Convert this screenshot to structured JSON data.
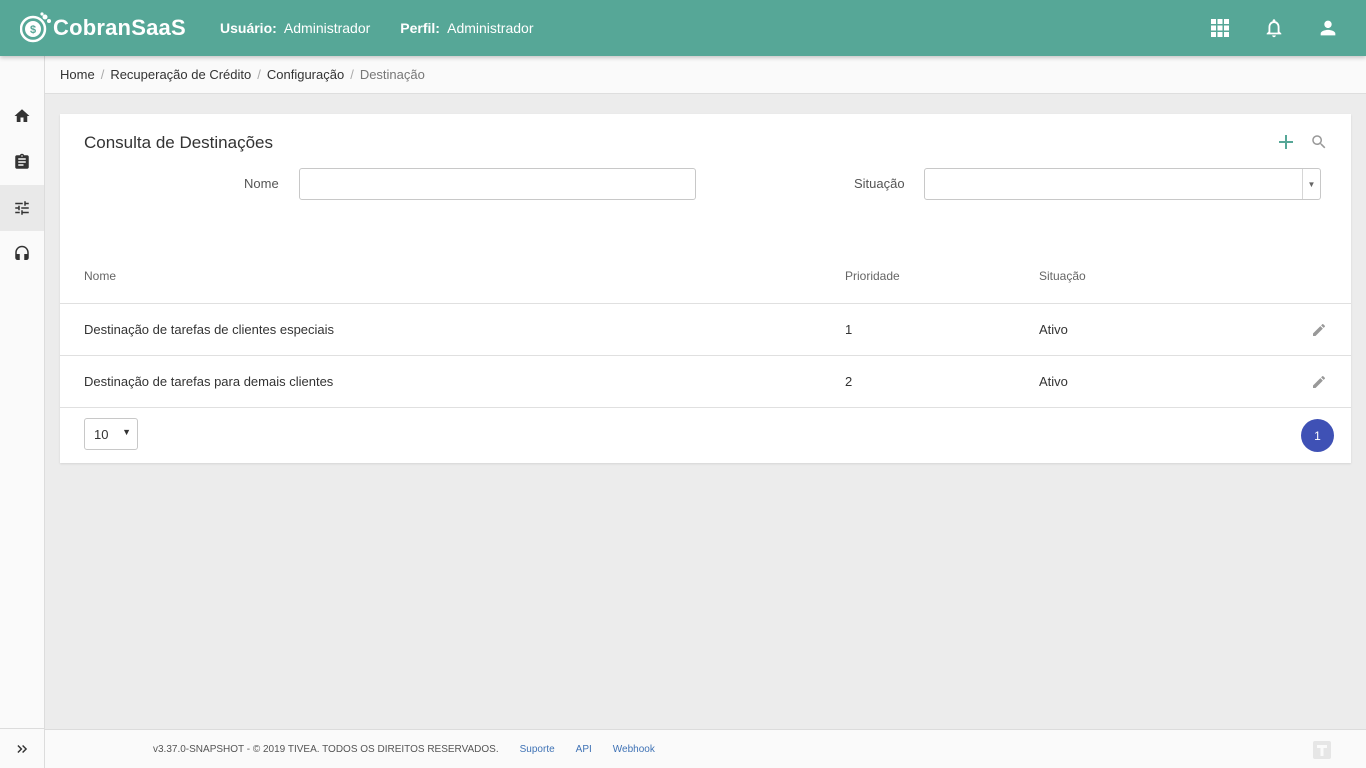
{
  "header": {
    "brand": "CobranSaaS",
    "user_label": "Usuário:",
    "user_value": "Administrador",
    "profile_label": "Perfil:",
    "profile_value": "Administrador",
    "accent": "#56a797",
    "icons": [
      "apps-grid-icon",
      "bell-icon",
      "user-icon"
    ]
  },
  "sidebar": {
    "items": [
      {
        "icon": "home-icon"
      },
      {
        "icon": "clipboard-icon"
      },
      {
        "icon": "sliders-icon",
        "active": true
      },
      {
        "icon": "headset-icon"
      }
    ],
    "expand_icon": "double-chevron-right-icon"
  },
  "breadcrumb": {
    "items": [
      "Home",
      "Recuperação de Crédito",
      "Configuração",
      "Destinação"
    ],
    "separator": "/"
  },
  "card": {
    "title": "Consulta de Destinações",
    "actions": [
      "plus-icon",
      "search-icon"
    ]
  },
  "filters": {
    "nome_label": "Nome",
    "nome_value": "",
    "situacao_label": "Situação",
    "situacao_value": ""
  },
  "table": {
    "columns": [
      "Nome",
      "Prioridade",
      "Situação"
    ],
    "rows": [
      {
        "nome": "Destinação de tarefas de clientes especiais",
        "prioridade": "1",
        "situacao": "Ativo"
      },
      {
        "nome": "Destinação de tarefas para demais clientes",
        "prioridade": "2",
        "situacao": "Ativo"
      }
    ]
  },
  "pagination": {
    "page_size": "10",
    "current_page": "1",
    "page_color": "#3f51b5"
  },
  "footer": {
    "copyright": "v3.37.0-SNAPSHOT - © 2019 TIVEA. TODOS OS DIREITOS RESERVADOS.",
    "links": [
      "Suporte",
      "API",
      "Webhook"
    ]
  }
}
